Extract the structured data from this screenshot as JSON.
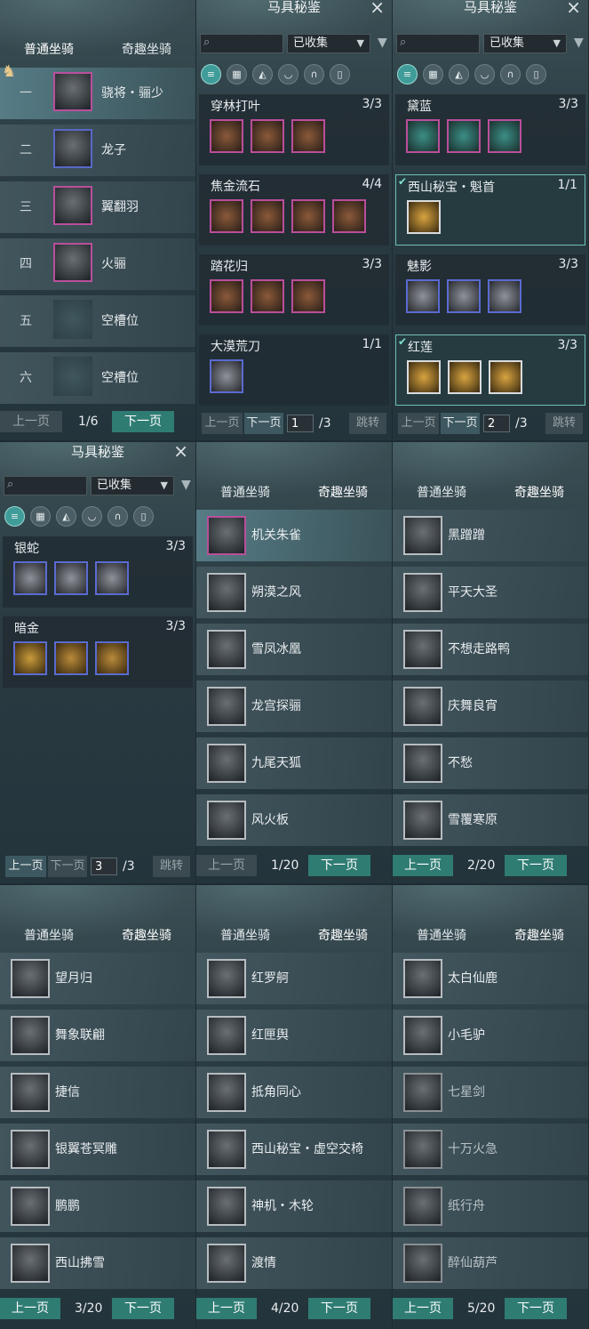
{
  "tabs": {
    "normal": "普通坐骑",
    "fun": "奇趣坐骑"
  },
  "pager": {
    "prev": "上一页",
    "next": "下一页",
    "jump": "跳转"
  },
  "codex": {
    "title": "马具秘鉴",
    "filter_value": "已收集",
    "close": "×",
    "category_icons": [
      "all-icon",
      "grid-icon",
      "saddle-icon",
      "armor-icon",
      "horseshoe-icon",
      "leg-guard-icon"
    ]
  },
  "panel_slots": {
    "page": "1/6",
    "rows": [
      {
        "num": "一",
        "name": "骁将・骊少"
      },
      {
        "num": "二",
        "name": "龙子"
      },
      {
        "num": "三",
        "name": "翼翻羽"
      },
      {
        "num": "四",
        "name": "火骊"
      },
      {
        "num": "五",
        "name": "空槽位"
      },
      {
        "num": "六",
        "name": "空槽位"
      }
    ]
  },
  "codex_page1": {
    "page_input": "1",
    "total": "/3",
    "sets": [
      {
        "name": "穿林打叶",
        "count": "3/3"
      },
      {
        "name": "焦金流石",
        "count": "4/4"
      },
      {
        "name": "踏花归",
        "count": "3/3"
      },
      {
        "name": "大漠荒刀",
        "count": "1/1"
      }
    ]
  },
  "codex_page2": {
    "page_input": "2",
    "total": "/3",
    "sets": [
      {
        "name": "黛蓝",
        "count": "3/3"
      },
      {
        "name": "西山秘宝・魁首",
        "count": "1/1"
      },
      {
        "name": "魅影",
        "count": "3/3"
      },
      {
        "name": "红莲",
        "count": "3/3"
      }
    ]
  },
  "codex_page3": {
    "page_input": "3",
    "total": "/3",
    "sets": [
      {
        "name": "银蛇",
        "count": "3/3"
      },
      {
        "name": "暗金",
        "count": "3/3"
      }
    ]
  },
  "fun_page1": {
    "page": "1/20",
    "names": [
      "机关朱雀",
      "朔漠之风",
      "雪凤冰凰",
      "龙宫探骊",
      "九尾天狐",
      "风火板"
    ]
  },
  "fun_page2": {
    "page": "2/20",
    "names": [
      "黑蹭蹭",
      "平天大圣",
      "不想走路鸭",
      "庆舞良宵",
      "不愁",
      "雪覆寒原"
    ]
  },
  "fun_page3": {
    "page": "3/20",
    "names": [
      "望月归",
      "舞象联翩",
      "捷信",
      "银翼苍冥雕",
      "鹏鹏",
      "西山拂雪"
    ]
  },
  "fun_page4": {
    "page": "4/20",
    "names": [
      "红罗舸",
      "红匣舆",
      "抵角同心",
      "西山秘宝・虚空交椅",
      "神机・木轮",
      "渡情"
    ]
  },
  "fun_page5": {
    "page": "5/20",
    "names": [
      "太白仙鹿",
      "小毛驴",
      "七星剑",
      "十万火急",
      "纸行舟",
      "醉仙葫芦"
    ]
  }
}
